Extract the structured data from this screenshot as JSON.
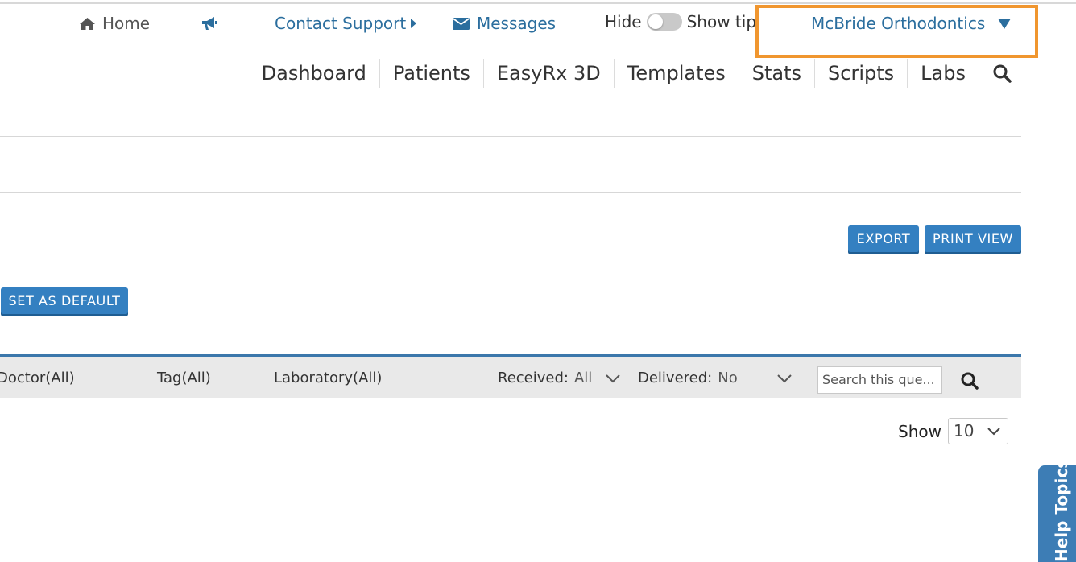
{
  "topbar": {
    "home_label": "Home",
    "contact_support_label": "Contact Support",
    "messages_label": "Messages",
    "tips_hide_label": "Hide",
    "tips_show_label": "Show tip",
    "practice_name": "McBride Orthodontics"
  },
  "nav": {
    "items": [
      "Dashboard",
      "Patients",
      "EasyRx 3D",
      "Templates",
      "Stats",
      "Scripts",
      "Labs"
    ]
  },
  "actions": {
    "export_label": "EXPORT",
    "print_view_label": "PRINT VIEW",
    "set_default_label": "SET AS DEFAULT"
  },
  "filters": {
    "doctor_label": "Doctor(All)",
    "tag_label": "Tag(All)",
    "laboratory_label": "Laboratory(All)",
    "received_label": "Received:",
    "received_value": "All",
    "delivered_label": "Delivered:",
    "delivered_value": "No",
    "search_placeholder": "Search this que..."
  },
  "pagination": {
    "show_label": "Show",
    "page_size": "10"
  },
  "help": {
    "tab_label": "Help Topics"
  },
  "colors": {
    "link_blue": "#2b6e9e",
    "button_blue": "#3480c1",
    "highlight_orange": "#f0962f",
    "filter_bar_bg": "#e9e9e9"
  },
  "icons": {
    "home": "home-icon",
    "announcements": "megaphone-icon",
    "messages": "envelope-icon",
    "search": "search-icon"
  }
}
